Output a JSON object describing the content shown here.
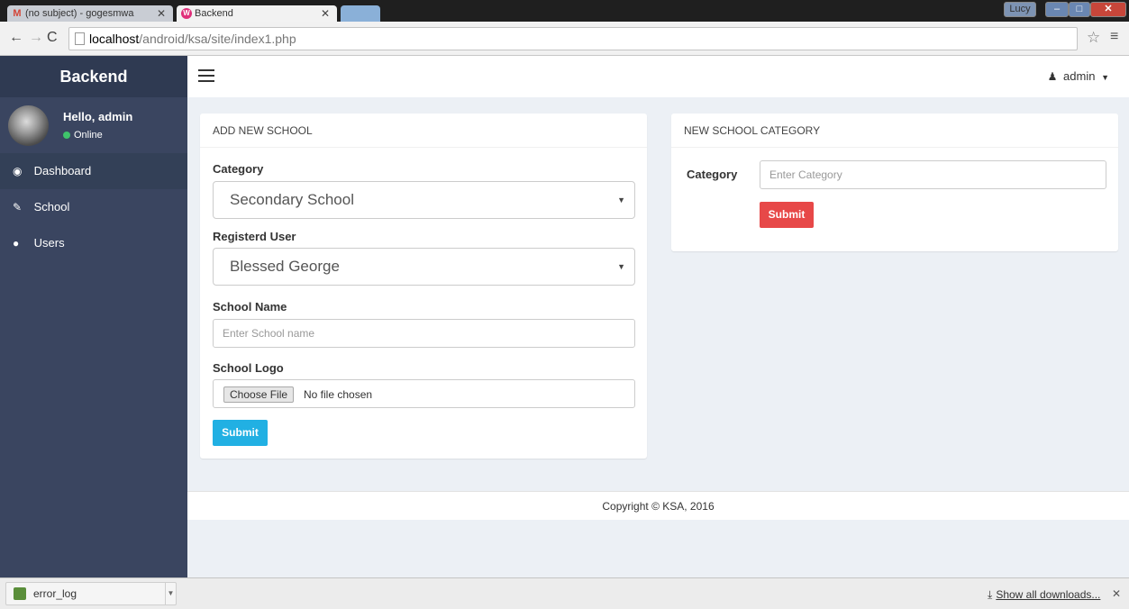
{
  "browser": {
    "tabs": [
      {
        "title": "(no subject) - gogesmwa",
        "icon": "gmail-icon"
      },
      {
        "title": "Backend",
        "icon": "backend-favicon"
      }
    ],
    "url_host": "localhost",
    "url_path": "/android/ksa/site/index1.php",
    "user_label": "Lucy"
  },
  "sidebar": {
    "brand": "Backend",
    "greeting": "Hello, admin",
    "status": "Online",
    "items": [
      {
        "label": "Dashboard",
        "icon": "dashboard-icon"
      },
      {
        "label": "School",
        "icon": "wrench-icon"
      },
      {
        "label": "Users",
        "icon": "globe-icon"
      }
    ]
  },
  "header": {
    "user_label": "admin"
  },
  "add_school": {
    "title": "ADD NEW SCHOOL",
    "category_label": "Category",
    "category_value": "Secondary School",
    "user_label": "Registerd User",
    "user_value": "Blessed George",
    "name_label": "School Name",
    "name_placeholder": "Enter School name",
    "logo_label": "School Logo",
    "choose_file": "Choose File",
    "no_file": "No file chosen",
    "submit": "Submit"
  },
  "new_category": {
    "title": "NEW SCHOOL CATEGORY",
    "category_label": "Category",
    "category_placeholder": "Enter Category",
    "submit": "Submit"
  },
  "footer": {
    "copyright": "Copyright © KSA, 2016"
  },
  "downloads": {
    "file": "error_log",
    "show_all": "Show all downloads..."
  },
  "colors": {
    "sidebar_bg": "#3a4560",
    "brand_bg": "#2f3a52",
    "submit_blue": "#21b0e3",
    "submit_red": "#e74848",
    "online_green": "#3fc36b"
  }
}
